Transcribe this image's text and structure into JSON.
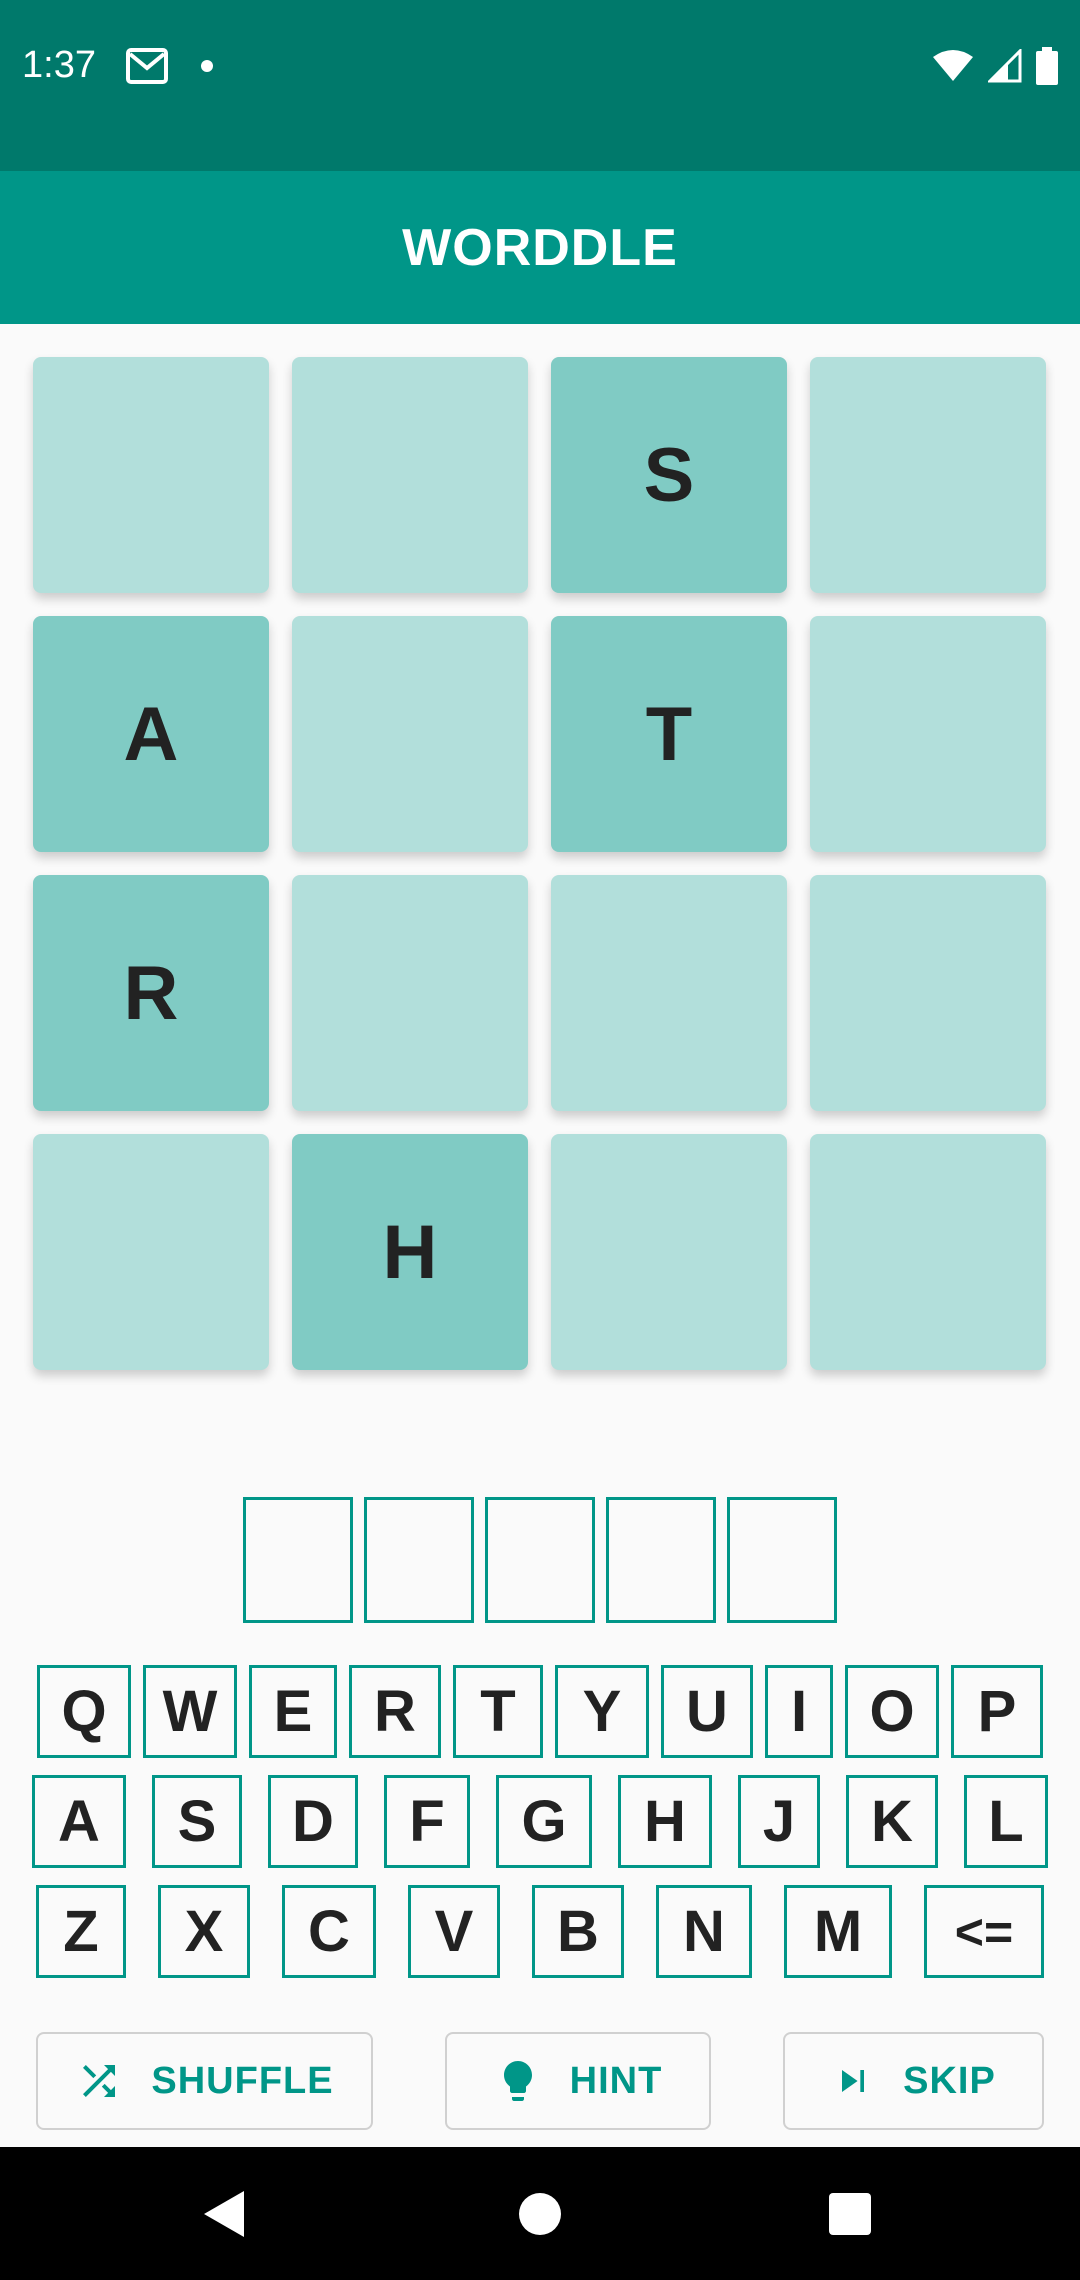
{
  "status_bar": {
    "time": "1:37"
  },
  "app_bar": {
    "title": "WORDDLE"
  },
  "grid": [
    [
      "",
      "",
      "S",
      ""
    ],
    [
      "A",
      "",
      "T",
      ""
    ],
    [
      "R",
      "",
      "",
      ""
    ],
    [
      "",
      "H",
      "",
      ""
    ]
  ],
  "answer_slots": [
    "",
    "",
    "",
    "",
    ""
  ],
  "keyboard": {
    "row1": [
      "Q",
      "W",
      "E",
      "R",
      "T",
      "Y",
      "U",
      "I",
      "O",
      "P"
    ],
    "row2": [
      "A",
      "S",
      "D",
      "F",
      "G",
      "H",
      "J",
      "K",
      "L"
    ],
    "row3": [
      "Z",
      "X",
      "C",
      "V",
      "B",
      "N",
      "M",
      "<="
    ]
  },
  "actions": {
    "shuffle": "SHUFFLE",
    "hint": "HINT",
    "skip": "SKIP"
  },
  "colors": {
    "status_bar": "#00796b",
    "app_bar": "#009688",
    "tile": "#b2dfdb",
    "tile_active": "#80cbc4",
    "accent": "#009688"
  },
  "icons": {
    "shuffle": "shuffle-icon",
    "hint": "lightbulb-icon",
    "skip": "skip-next-icon"
  }
}
